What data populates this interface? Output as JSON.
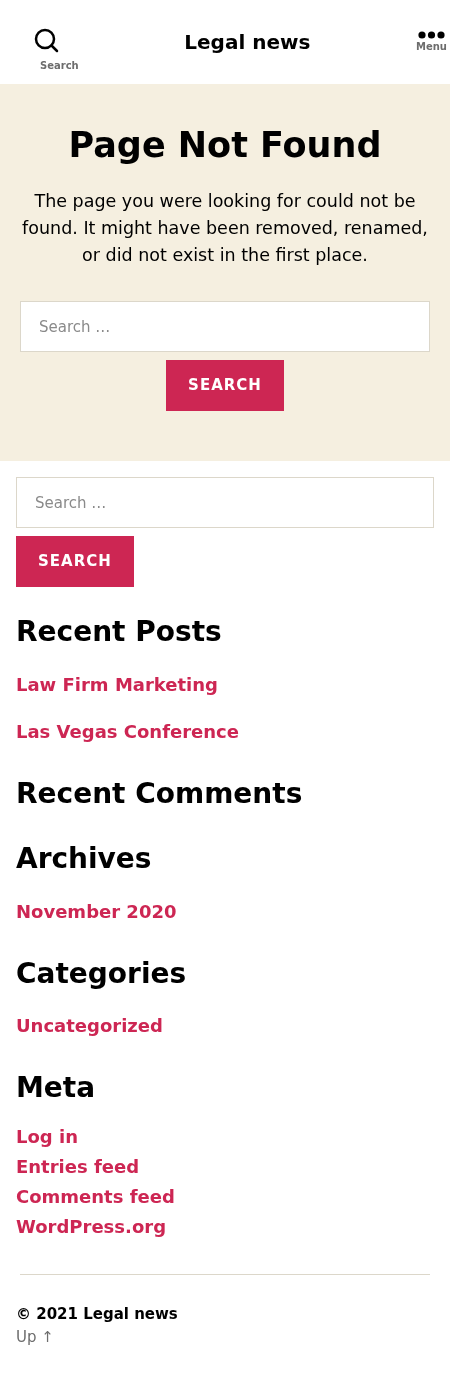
{
  "header": {
    "search_label": "Search",
    "title": "Legal news",
    "menu_label": "Menu"
  },
  "hero": {
    "title": "Page Not Found",
    "text": "The page you were looking for could not be found. It might have been removed, renamed, or did not exist in the first place.",
    "search": {
      "placeholder": "Search …",
      "button": "SEARCH"
    }
  },
  "sidebar_search": {
    "placeholder": "Search …",
    "button": "SEARCH"
  },
  "widgets": [
    {
      "title": "Recent Posts",
      "kind": "spaced",
      "links": [
        "Law Firm Marketing",
        "Las Vegas Conference"
      ]
    },
    {
      "title": "Recent Comments",
      "kind": "spaced"
    },
    {
      "title": "Archives",
      "kind": "spaced",
      "links": [
        "November 2020"
      ]
    },
    {
      "title": "Categories",
      "kind": "spaced",
      "links": [
        "Uncategorized"
      ]
    },
    {
      "title": "Meta",
      "kind": "compact",
      "links": [
        "Log in",
        "Entries feed",
        "Comments feed",
        "WordPress.org"
      ]
    }
  ],
  "footer": {
    "copyright": "© 2021 Legal news",
    "up_link": "Up ↑"
  }
}
